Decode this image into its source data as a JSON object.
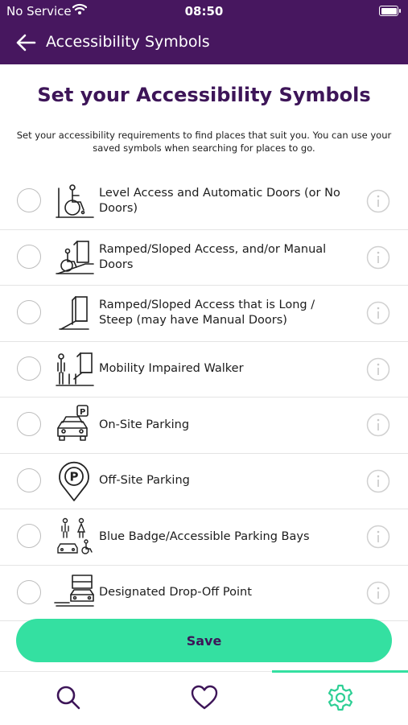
{
  "status": {
    "carrier": "No Service",
    "time": "08:50"
  },
  "nav": {
    "title": "Accessibility Symbols"
  },
  "heading": "Set your Accessibility Symbols",
  "subtitle": "Set your accessibility requirements to find places that suit you. You can use your saved symbols when searching for places to go.",
  "items": [
    {
      "label": "Level Access and Automatic Doors (or No Doors)",
      "icon": "wheelchair-level-access-icon",
      "selected": false
    },
    {
      "label": "Ramped/Sloped Access, and/or Manual Doors",
      "icon": "wheelchair-ramp-icon",
      "selected": false
    },
    {
      "label": "Ramped/Sloped Access that is Long / Steep (may have Manual Doors)",
      "icon": "steep-ramp-icon",
      "selected": false
    },
    {
      "label": "Mobility Impaired Walker",
      "icon": "walker-icon",
      "selected": false
    },
    {
      "label": "On-Site Parking",
      "icon": "car-parking-icon",
      "selected": false
    },
    {
      "label": "Off-Site Parking",
      "icon": "parking-pin-icon",
      "selected": false
    },
    {
      "label": "Blue Badge/Accessible Parking Bays",
      "icon": "blue-badge-icon",
      "selected": false
    },
    {
      "label": "Designated Drop-Off Point",
      "icon": "drop-off-icon",
      "selected": false
    }
  ],
  "save_label": "Save",
  "tabs": [
    {
      "name": "search",
      "icon": "search-icon",
      "active": false
    },
    {
      "name": "favourites",
      "icon": "heart-icon",
      "active": false
    },
    {
      "name": "settings",
      "icon": "gear-icon",
      "active": true
    }
  ],
  "colors": {
    "brand": "#47175f",
    "accent": "#34e0a1",
    "heading": "#3d1558"
  }
}
